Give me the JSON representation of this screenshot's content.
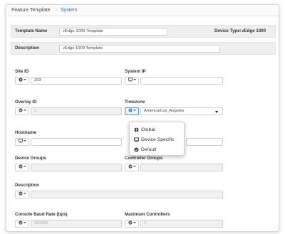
{
  "breadcrumb": {
    "parent": "Feature Template",
    "separator": "›",
    "current": "System"
  },
  "template_name": {
    "label": "Template Name",
    "value": "vEdge-1000-Template"
  },
  "device_type": {
    "label": "Device Type:",
    "value": "vEdge 1000"
  },
  "description_top": {
    "label": "Description",
    "value": "vEdge 1000 Template"
  },
  "site_id": {
    "label": "Site ID",
    "value": "203"
  },
  "system_ip": {
    "label": "System IP",
    "value": ""
  },
  "overlay_id": {
    "label": "Overlay ID",
    "value": "1"
  },
  "timezone": {
    "label": "Timezone",
    "value": "America/Los_Angeles"
  },
  "hostname": {
    "label": "Hostname",
    "value": ""
  },
  "device_groups": {
    "label": "Device Groups",
    "value": ""
  },
  "controller_groups": {
    "label": "Controller Groups",
    "value": ""
  },
  "description": {
    "label": "Description",
    "value": ""
  },
  "console_baud_rate": {
    "label": "Console Baud Rate (bps)",
    "value": "115200"
  },
  "max_controllers": {
    "label": "Maximum Controllers",
    "value": "2"
  },
  "scope_menu": {
    "items": [
      {
        "label": "Global"
      },
      {
        "label": "Device Specific"
      },
      {
        "label": "Default"
      }
    ]
  },
  "colors": {
    "accent": "#1a75c8",
    "active_border": "#4a8fd6"
  },
  "icons": {
    "global": "globe-icon",
    "device_specific": "monitor-icon",
    "default": "check-circle-icon"
  }
}
